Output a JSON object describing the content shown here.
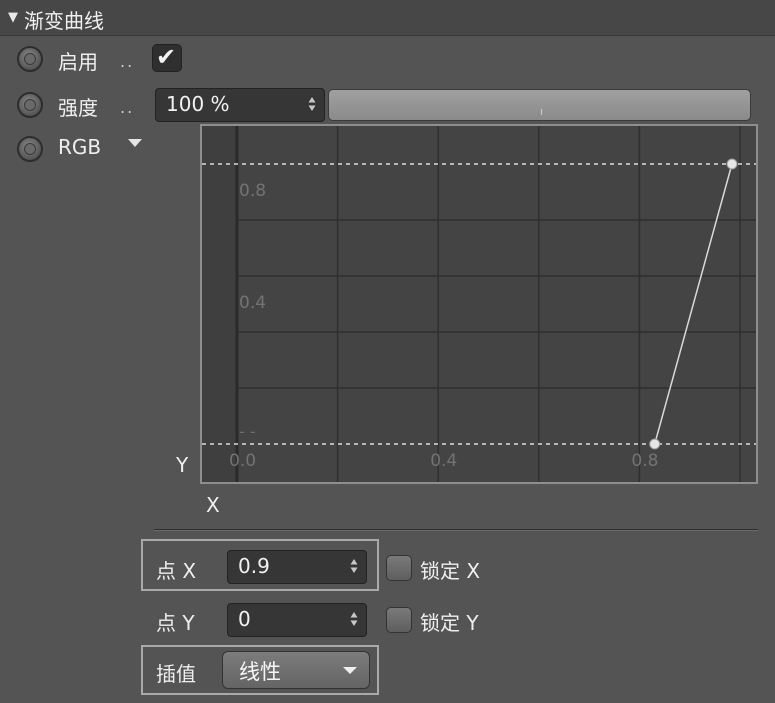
{
  "panel": {
    "title": "渐变曲线"
  },
  "enable": {
    "label": "启用",
    "dots": "..",
    "checked": true,
    "check_glyph": "✔"
  },
  "strength": {
    "label": "强度",
    "dots": "..",
    "value": "100 %",
    "slider_fraction": 1.0
  },
  "channel": {
    "label": "RGB"
  },
  "curve": {
    "y_axis_label": "Y",
    "x_axis_label": "X",
    "x_ticks": [
      "0.0",
      "0.4",
      "0.8"
    ],
    "y_ticks": [
      "0.8",
      "0.4"
    ],
    "points": [
      {
        "x": 0.9,
        "y": 0
      },
      {
        "x": 1.0,
        "y": 1.0
      }
    ]
  },
  "point_x": {
    "label": "点 X",
    "value": "0.9",
    "lock_label": "锁定 X"
  },
  "point_y": {
    "label": "点 Y",
    "value": "0",
    "lock_label": "锁定 Y"
  },
  "interpolation": {
    "label": "插值",
    "value": "线性"
  },
  "colors": {
    "panel_bg": "#545454",
    "header_bg": "#474747",
    "curve_line": "#d9d9d9"
  }
}
